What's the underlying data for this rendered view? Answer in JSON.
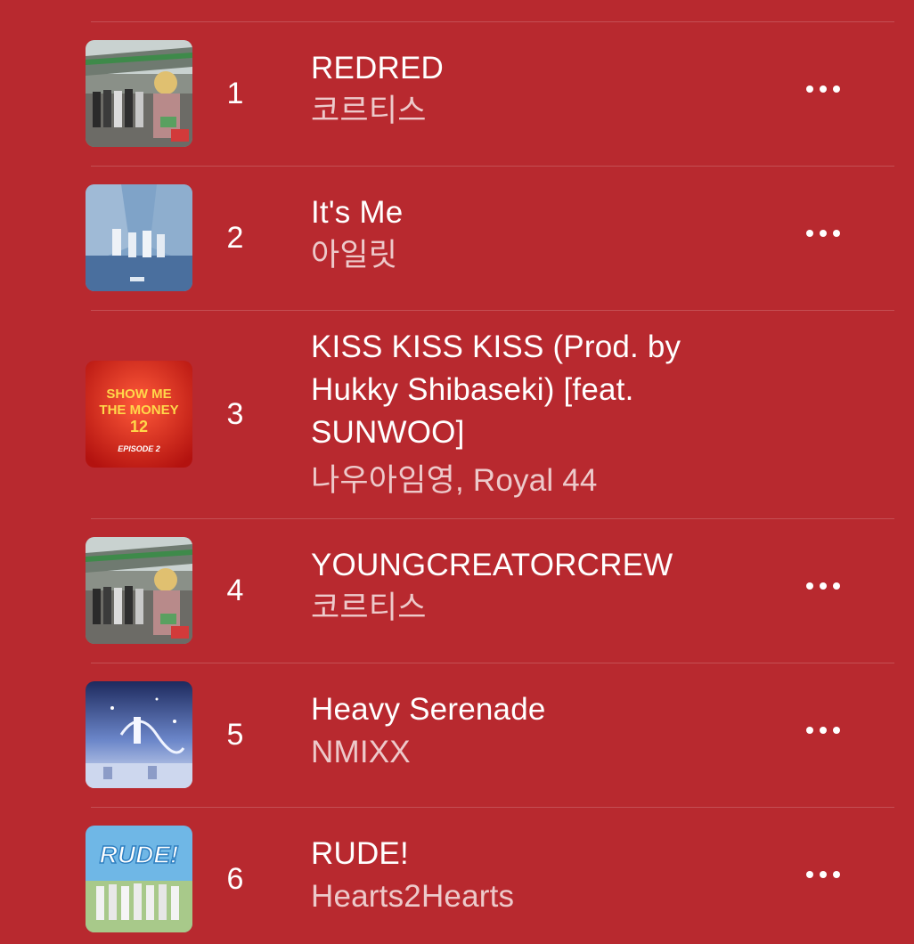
{
  "colors": {
    "background": "#b8292f",
    "text_primary": "#ffffff",
    "text_secondary": "rgba(255,255,255,0.75)"
  },
  "tracks": [
    {
      "rank": "1",
      "title": "REDRED",
      "artist": "코르티스",
      "artwork_icon": "album-art-street-group"
    },
    {
      "rank": "2",
      "title": "It's Me",
      "artist": "아일릿",
      "artwork_icon": "album-art-alley-dancers"
    },
    {
      "rank": "3",
      "title_lines": [
        "KISS KISS KISS (Prod. by",
        "Hukky Shibaseki) [feat.",
        "SUNWOO]"
      ],
      "artist": "나우아임영, Royal 44",
      "artwork_icon": "album-art-show-me-the-money",
      "artwork_text": {
        "line1": "SHOW ME",
        "line2": "THE MONEY",
        "line3": "12",
        "line4": "EPISODE 2"
      }
    },
    {
      "rank": "4",
      "title": "YOUNGCREATORCREW",
      "artist": "코르티스",
      "artwork_icon": "album-art-street-group"
    },
    {
      "rank": "5",
      "title": "Heavy Serenade",
      "artist": "NMIXX",
      "artwork_icon": "album-art-blue-sky"
    },
    {
      "rank": "6",
      "title": "RUDE!",
      "artist": "Hearts2Hearts",
      "artwork_icon": "album-art-rude-logo",
      "artwork_text": {
        "logo": "RUDE!"
      }
    }
  ],
  "more_icon": "ellipsis-icon"
}
